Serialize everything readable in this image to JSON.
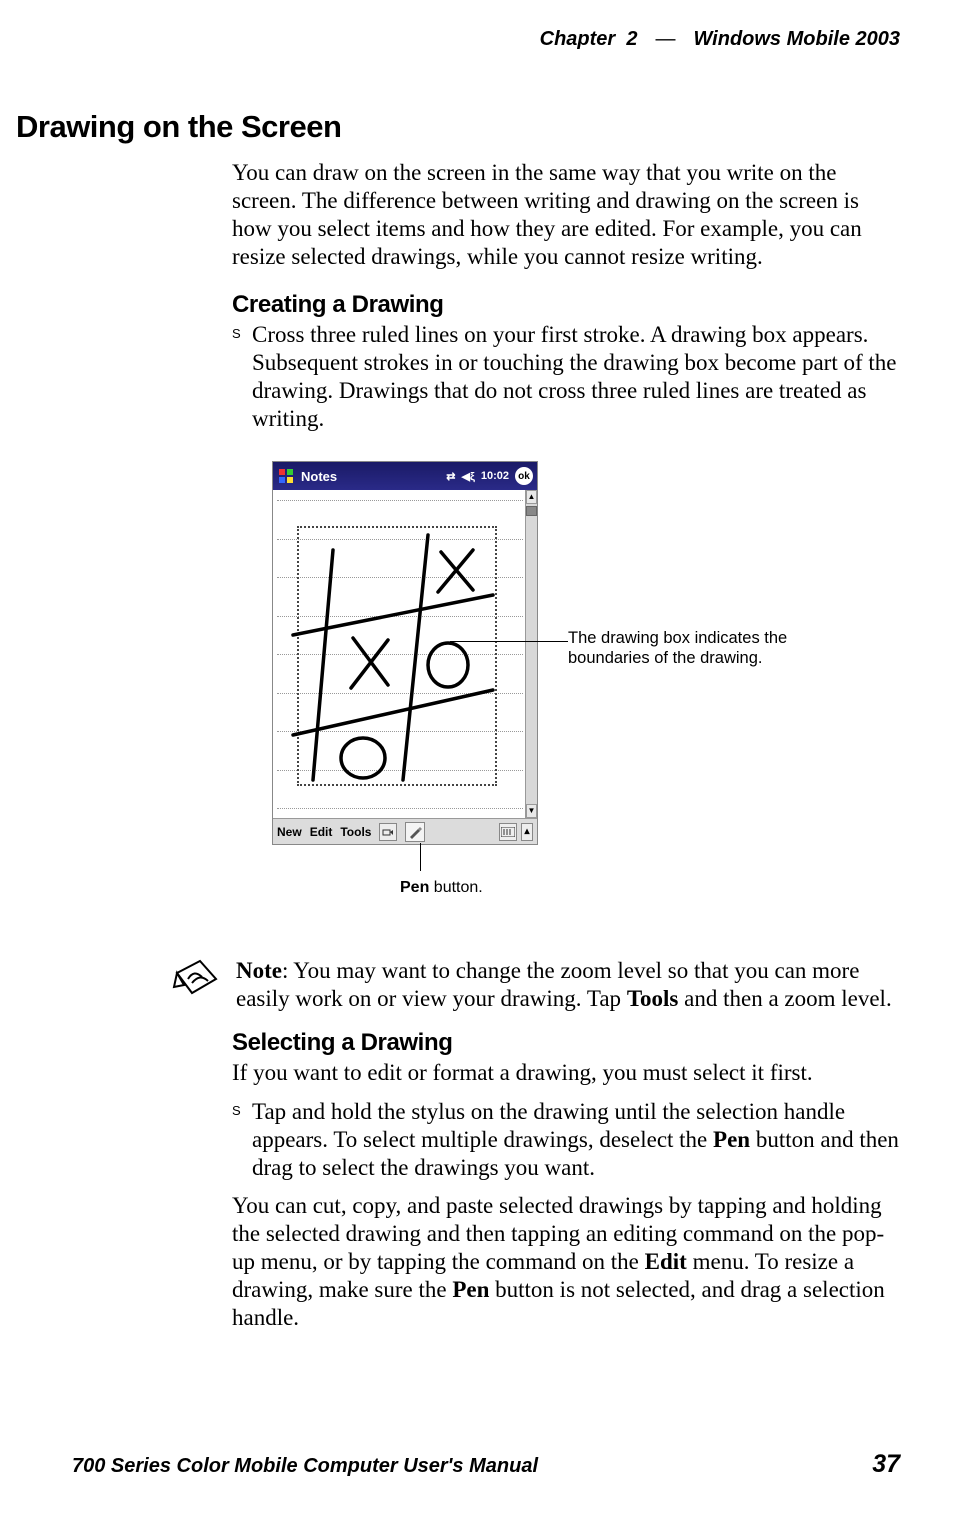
{
  "header": {
    "chapter_label": "Chapter",
    "chapter_number": "2",
    "separator": "—",
    "book_title": "Windows Mobile 2003"
  },
  "section_title": "Drawing on the Screen",
  "intro_para": "You can draw on the screen in the same way that you write on the screen. The difference between writing and drawing on the screen is how you select items and how they are edited. For example, you can resize selected drawings, while you cannot resize writing.",
  "creating": {
    "heading": "Creating a Drawing",
    "bullet1": "Cross three ruled lines on your first stroke. A drawing box appears. Subsequent strokes in or touching the drawing box become part of the drawing. Drawings that do not cross three ruled lines are treated as writing."
  },
  "figure": {
    "app_title": "Notes",
    "time": "10:02",
    "ok": "ok",
    "menu": {
      "new": "New",
      "edit": "Edit",
      "tools": "Tools"
    },
    "callout_box": "The drawing box indicates the boundaries of the drawing.",
    "callout_pen_bold": "Pen",
    "callout_pen_rest": " button."
  },
  "note": {
    "bold": "Note",
    "colon_text": ": You may want to change the zoom level so that you can more easily work on or view your drawing. Tap ",
    "tools_word": "Tools",
    "after_tools": " and then a zoom level."
  },
  "selecting": {
    "heading": "Selecting a Drawing",
    "intro": "If you want to edit or format a drawing, you must select it first.",
    "bullet_pre": "Tap and hold the stylus on the drawing until the selection handle appears. To select multiple drawings, deselect the ",
    "pen_word": "Pen",
    "bullet_post": " button and then drag to select the drawings you want.",
    "para2_a": "You can cut, copy, and paste selected drawings by tapping and holding the selected drawing and then tapping an editing command on the pop-up menu, or by tapping the command on the ",
    "edit_word": "Edit",
    "para2_b": " menu. To resize a drawing, make sure the ",
    "pen_word2": "Pen",
    "para2_c": " button is not selected, and drag a selection handle."
  },
  "footer": {
    "manual_title": "700 Series Color Mobile Computer User's Manual",
    "page_number": "37"
  }
}
